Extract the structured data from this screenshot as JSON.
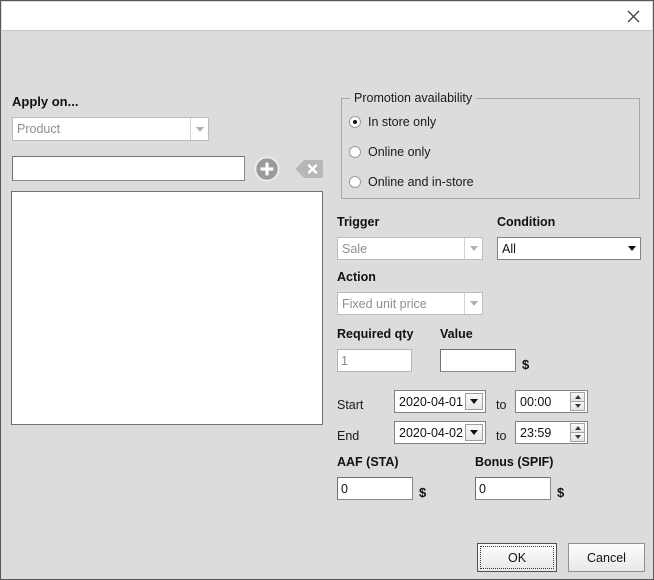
{
  "window": {
    "title": "",
    "close_icon": "close-icon",
    "background_color": "#dcdcdc",
    "titlebar_color": "#ffffff",
    "border_color": "#555759"
  },
  "left_panel": {
    "apply_on_label": "Apply on...",
    "apply_on_select": {
      "value": "Product",
      "disabled": true
    },
    "search_input": {
      "value": "",
      "placeholder": ""
    },
    "add_button": {
      "icon": "plus-circle-icon",
      "label": ""
    },
    "clear_button": {
      "icon": "erase-backspace-icon",
      "label": ""
    },
    "items_list": {
      "items": []
    }
  },
  "availability": {
    "legend": "Promotion availability",
    "options": [
      {
        "label": "In store only",
        "checked": true
      },
      {
        "label": "Online only",
        "checked": false
      },
      {
        "label": "Online and in-store",
        "checked": false
      }
    ]
  },
  "rules": {
    "trigger_label": "Trigger",
    "trigger_select": {
      "value": "Sale",
      "disabled": true
    },
    "condition_label": "Condition",
    "condition_select": {
      "value": "All",
      "disabled": false
    },
    "action_label": "Action",
    "action_select": {
      "value": "Fixed unit price",
      "disabled": true
    },
    "required_qty_label": "Required qty",
    "required_qty_input": {
      "value": "1",
      "disabled": true
    },
    "value_label": "Value",
    "value_input": {
      "value": "",
      "disabled": false
    },
    "value_currency": "$"
  },
  "schedule": {
    "start_label": "Start",
    "start_date": "2020-04-01",
    "start_to": "to",
    "start_time": "00:00",
    "end_label": "End",
    "end_date": "2020-04-02",
    "end_to": "to",
    "end_time": "23:59"
  },
  "incentives": {
    "aaf_label": "AAF (STA)",
    "aaf_input": {
      "value": "0"
    },
    "aaf_currency": "$",
    "bonus_label": "Bonus (SPIF)",
    "bonus_input": {
      "value": "0"
    },
    "bonus_currency": "$"
  },
  "footer": {
    "ok_label": "OK",
    "cancel_label": "Cancel"
  }
}
